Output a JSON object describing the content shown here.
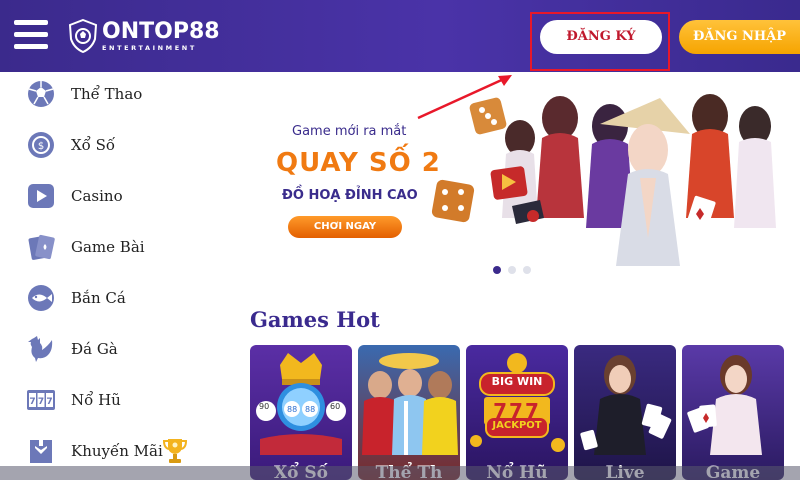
{
  "header": {
    "logo_text": "ONTOP88",
    "logo_sub": "ENTERTAINMENT",
    "register_label": "ĐĂNG KÝ",
    "login_label": "ĐĂNG NHẬP"
  },
  "sidebar": {
    "items": [
      {
        "label": "Thể Thao",
        "icon": "soccer-ball-icon"
      },
      {
        "label": "Xổ Số",
        "icon": "lottery-coin-icon"
      },
      {
        "label": "Casino",
        "icon": "play-icon"
      },
      {
        "label": "Game Bài",
        "icon": "cards-icon"
      },
      {
        "label": "Bắn Cá",
        "icon": "fish-icon"
      },
      {
        "label": "Đá Gà",
        "icon": "rooster-icon"
      },
      {
        "label": "Nổ Hũ",
        "icon": "slot-777-icon"
      },
      {
        "label": "Khuyến Mãi",
        "icon": "gift-icon"
      }
    ]
  },
  "banner": {
    "subtitle": "Game mới ra mắt",
    "title": "QUAY SỐ 2",
    "tagline": "ĐỒ HOẠ ĐỈNH CAO",
    "cta": "CHƠI NGAY",
    "slides": 3,
    "active_slide": 1
  },
  "games_hot": {
    "heading": "Games Hot",
    "cards": [
      {
        "label": "Xổ Số"
      },
      {
        "label": "Thể Th"
      },
      {
        "label": "Nổ Hũ"
      },
      {
        "label": "Live"
      },
      {
        "label": "Game"
      }
    ],
    "badge_big_win": "BIG WIN",
    "badge_jackpot": "JACKPOT",
    "slot_digits": "777",
    "lottery_balls": [
      "90",
      "88",
      "88",
      "60"
    ]
  },
  "colors": {
    "header_bg": "#3b2a8c",
    "accent_orange": "#f6a400",
    "register_text": "#c0182c",
    "highlight_red": "#e8182a"
  }
}
